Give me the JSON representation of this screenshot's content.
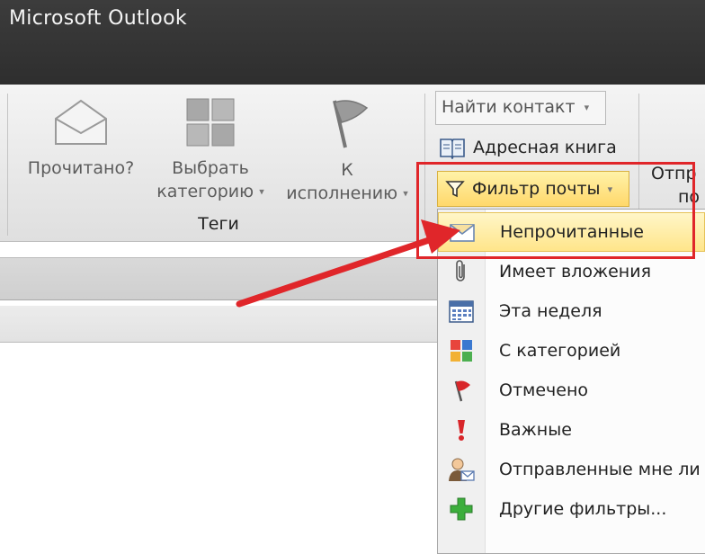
{
  "window": {
    "title": "Microsoft Outlook"
  },
  "ribbon": {
    "read_button": "Прочитано?",
    "categorize_button": [
      "Выбрать",
      "категорию"
    ],
    "followup_button": [
      "К",
      "исполнению"
    ],
    "tags_group_label": "Теги",
    "find_contact": "Найти контакт",
    "address_book": "Адресная книга",
    "filter_email": "Фильтр почты",
    "cut_off_text": [
      "Отпр",
      "по"
    ]
  },
  "filter_menu": {
    "items": [
      {
        "label": "Непрочитанные",
        "icon": "unread-envelope-icon",
        "highlighted": true
      },
      {
        "label": "Имеет вложения",
        "icon": "paperclip-icon"
      },
      {
        "label": "Эта неделя",
        "icon": "calendar-icon"
      },
      {
        "label": "С категорией",
        "icon": "categories-icon"
      },
      {
        "label": "Отмечено",
        "icon": "flag-icon"
      },
      {
        "label": "Важные",
        "icon": "exclamation-icon"
      },
      {
        "label": "Отправленные мне ли",
        "icon": "contact-mail-icon"
      },
      {
        "label": "Другие фильтры...",
        "icon": "plus-icon"
      }
    ]
  },
  "annotation": {
    "color": "#e0262a"
  }
}
